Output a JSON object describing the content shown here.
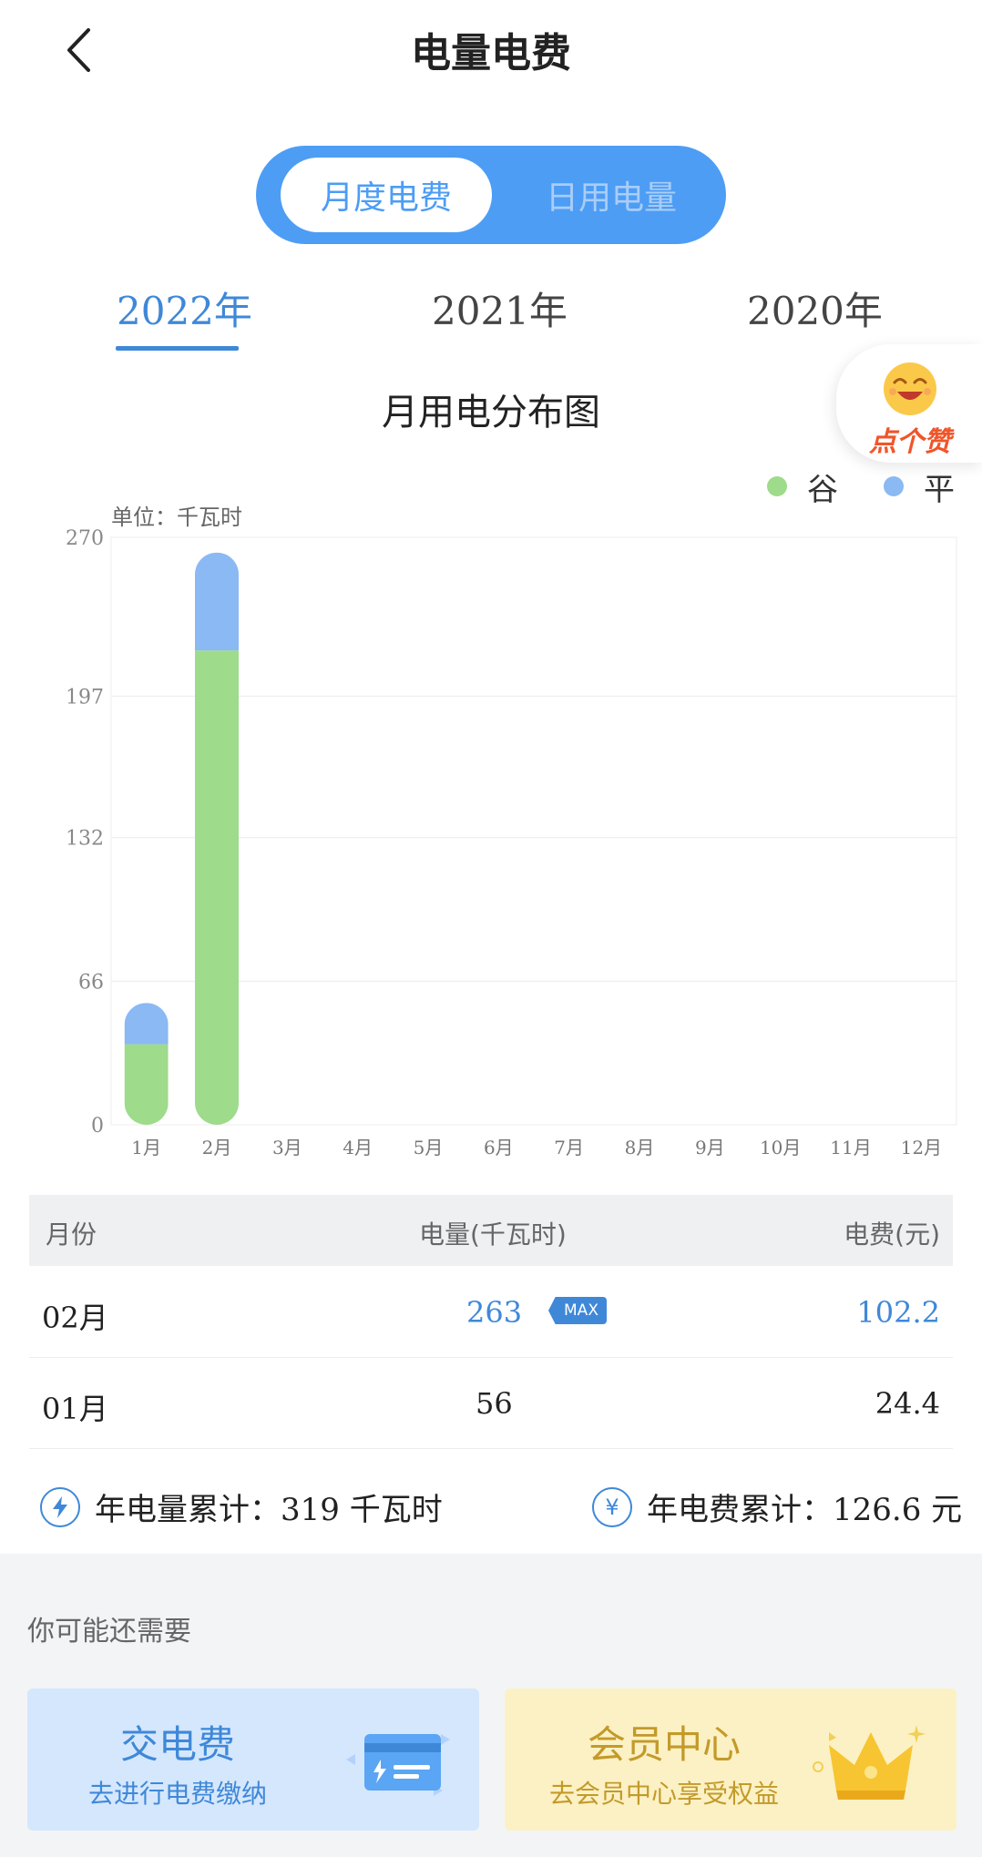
{
  "header": {
    "title": "电量电费"
  },
  "segment": {
    "active": "月度电费",
    "inactive": "日用电量"
  },
  "years": [
    "2022年",
    "2021年",
    "2020年"
  ],
  "like": {
    "text": "点个赞"
  },
  "chart_title": "月用电分布图",
  "unit_label": "单位：千瓦时",
  "chart_data": {
    "type": "bar",
    "stacked": true,
    "categories": [
      "1月",
      "2月",
      "3月",
      "4月",
      "5月",
      "6月",
      "7月",
      "8月",
      "9月",
      "10月",
      "11月",
      "12月"
    ],
    "series": [
      {
        "name": "谷",
        "color": "#9edb8b",
        "values": [
          37,
          218,
          0,
          0,
          0,
          0,
          0,
          0,
          0,
          0,
          0,
          0
        ]
      },
      {
        "name": "平",
        "color": "#8ab9f3",
        "values": [
          19,
          45,
          0,
          0,
          0,
          0,
          0,
          0,
          0,
          0,
          0,
          0
        ]
      }
    ],
    "y_ticks": [
      "0",
      "66",
      "132",
      "197",
      "270"
    ],
    "ylim": [
      0,
      270
    ],
    "grid": true
  },
  "table": {
    "headers": {
      "month": "月份",
      "usage": "电量(千瓦时)",
      "fee": "电费(元)"
    },
    "rows": [
      {
        "month": "02月",
        "usage": "263",
        "fee": "102.2",
        "badge": "MAX"
      },
      {
        "month": "01月",
        "usage": "56",
        "fee": "24.4"
      }
    ]
  },
  "summary": {
    "usage_label": "年电量累计：",
    "usage_value": "319 千瓦时",
    "fee_label": "年电费累计：",
    "fee_value": "126.6 元",
    "fee_icon_glyph": "¥"
  },
  "section": {
    "title": "你可能还需要",
    "cards": [
      {
        "title": "交电费",
        "subtitle": "去进行电费缴纳"
      },
      {
        "title": "会员中心",
        "subtitle": "去会员中心享受权益"
      }
    ]
  },
  "colors": {
    "accent": "#3f88d8",
    "segment_bg": "#4d9df5",
    "valley": "#9edb8b",
    "flat": "#8ab9f3"
  }
}
